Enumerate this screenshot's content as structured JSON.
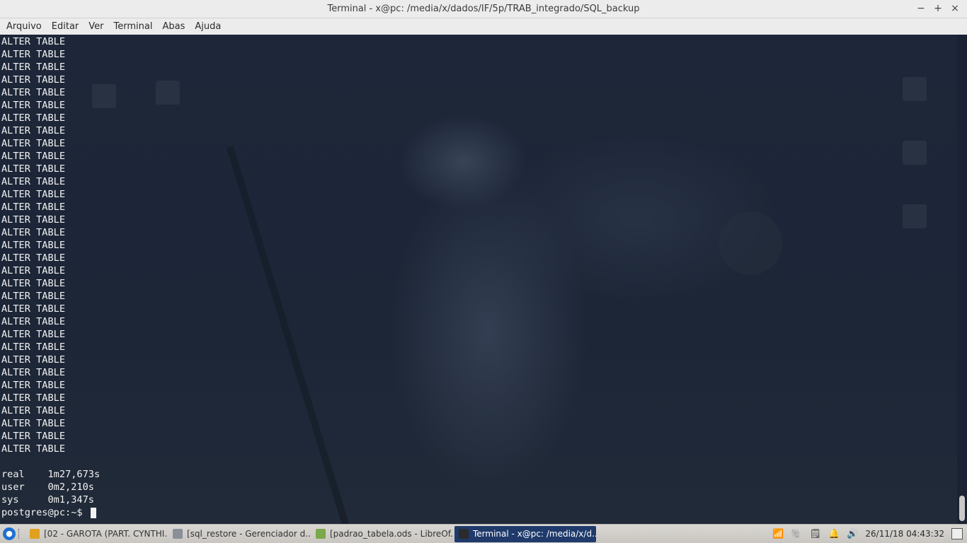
{
  "window": {
    "title": "Terminal - x@pc: /media/x/dados/IF/5p/TRAB_integrado/SQL_backup",
    "controls": {
      "minimize": "−",
      "maximize": "+",
      "close": "×"
    }
  },
  "menu": [
    "Arquivo",
    "Editar",
    "Ver",
    "Terminal",
    "Abas",
    "Ajuda"
  ],
  "terminal": {
    "lines": [
      "ALTER TABLE",
      "ALTER TABLE",
      "ALTER TABLE",
      "ALTER TABLE",
      "ALTER TABLE",
      "ALTER TABLE",
      "ALTER TABLE",
      "ALTER TABLE",
      "ALTER TABLE",
      "ALTER TABLE",
      "ALTER TABLE",
      "ALTER TABLE",
      "ALTER TABLE",
      "ALTER TABLE",
      "ALTER TABLE",
      "ALTER TABLE",
      "ALTER TABLE",
      "ALTER TABLE",
      "ALTER TABLE",
      "ALTER TABLE",
      "ALTER TABLE",
      "ALTER TABLE",
      "ALTER TABLE",
      "ALTER TABLE",
      "ALTER TABLE",
      "ALTER TABLE",
      "ALTER TABLE",
      "ALTER TABLE",
      "ALTER TABLE",
      "ALTER TABLE",
      "ALTER TABLE",
      "ALTER TABLE",
      "ALTER TABLE",
      "",
      "real\t1m27,673s",
      "user\t0m2,210s",
      "sys\t0m1,347s"
    ],
    "prompt": "postgres@pc:~$ "
  },
  "taskbar": {
    "tasks": [
      {
        "label": "[02 - GAROTA (PART. CYNTHI...",
        "icon": "chrome-icon",
        "color": "#e0a020",
        "active": false
      },
      {
        "label": "[sql_restore - Gerenciador d...",
        "icon": "folder-icon",
        "color": "#8a8f99",
        "active": false
      },
      {
        "label": "[padrao_tabela.ods - LibreOf...",
        "icon": "spreadsheet-icon",
        "color": "#7aa84a",
        "active": false
      },
      {
        "label": "Terminal - x@pc: /media/x/d...",
        "icon": "terminal-icon",
        "color": "#2b2b2b",
        "active": true
      }
    ],
    "clock": "26/11/18 04:43:32"
  },
  "colors": {
    "terminal_bg": "#1c2638",
    "terminal_fg": "#f2f2f2",
    "titlebar_bg": "#ececec",
    "taskbar_active": "#1f3a6b"
  }
}
